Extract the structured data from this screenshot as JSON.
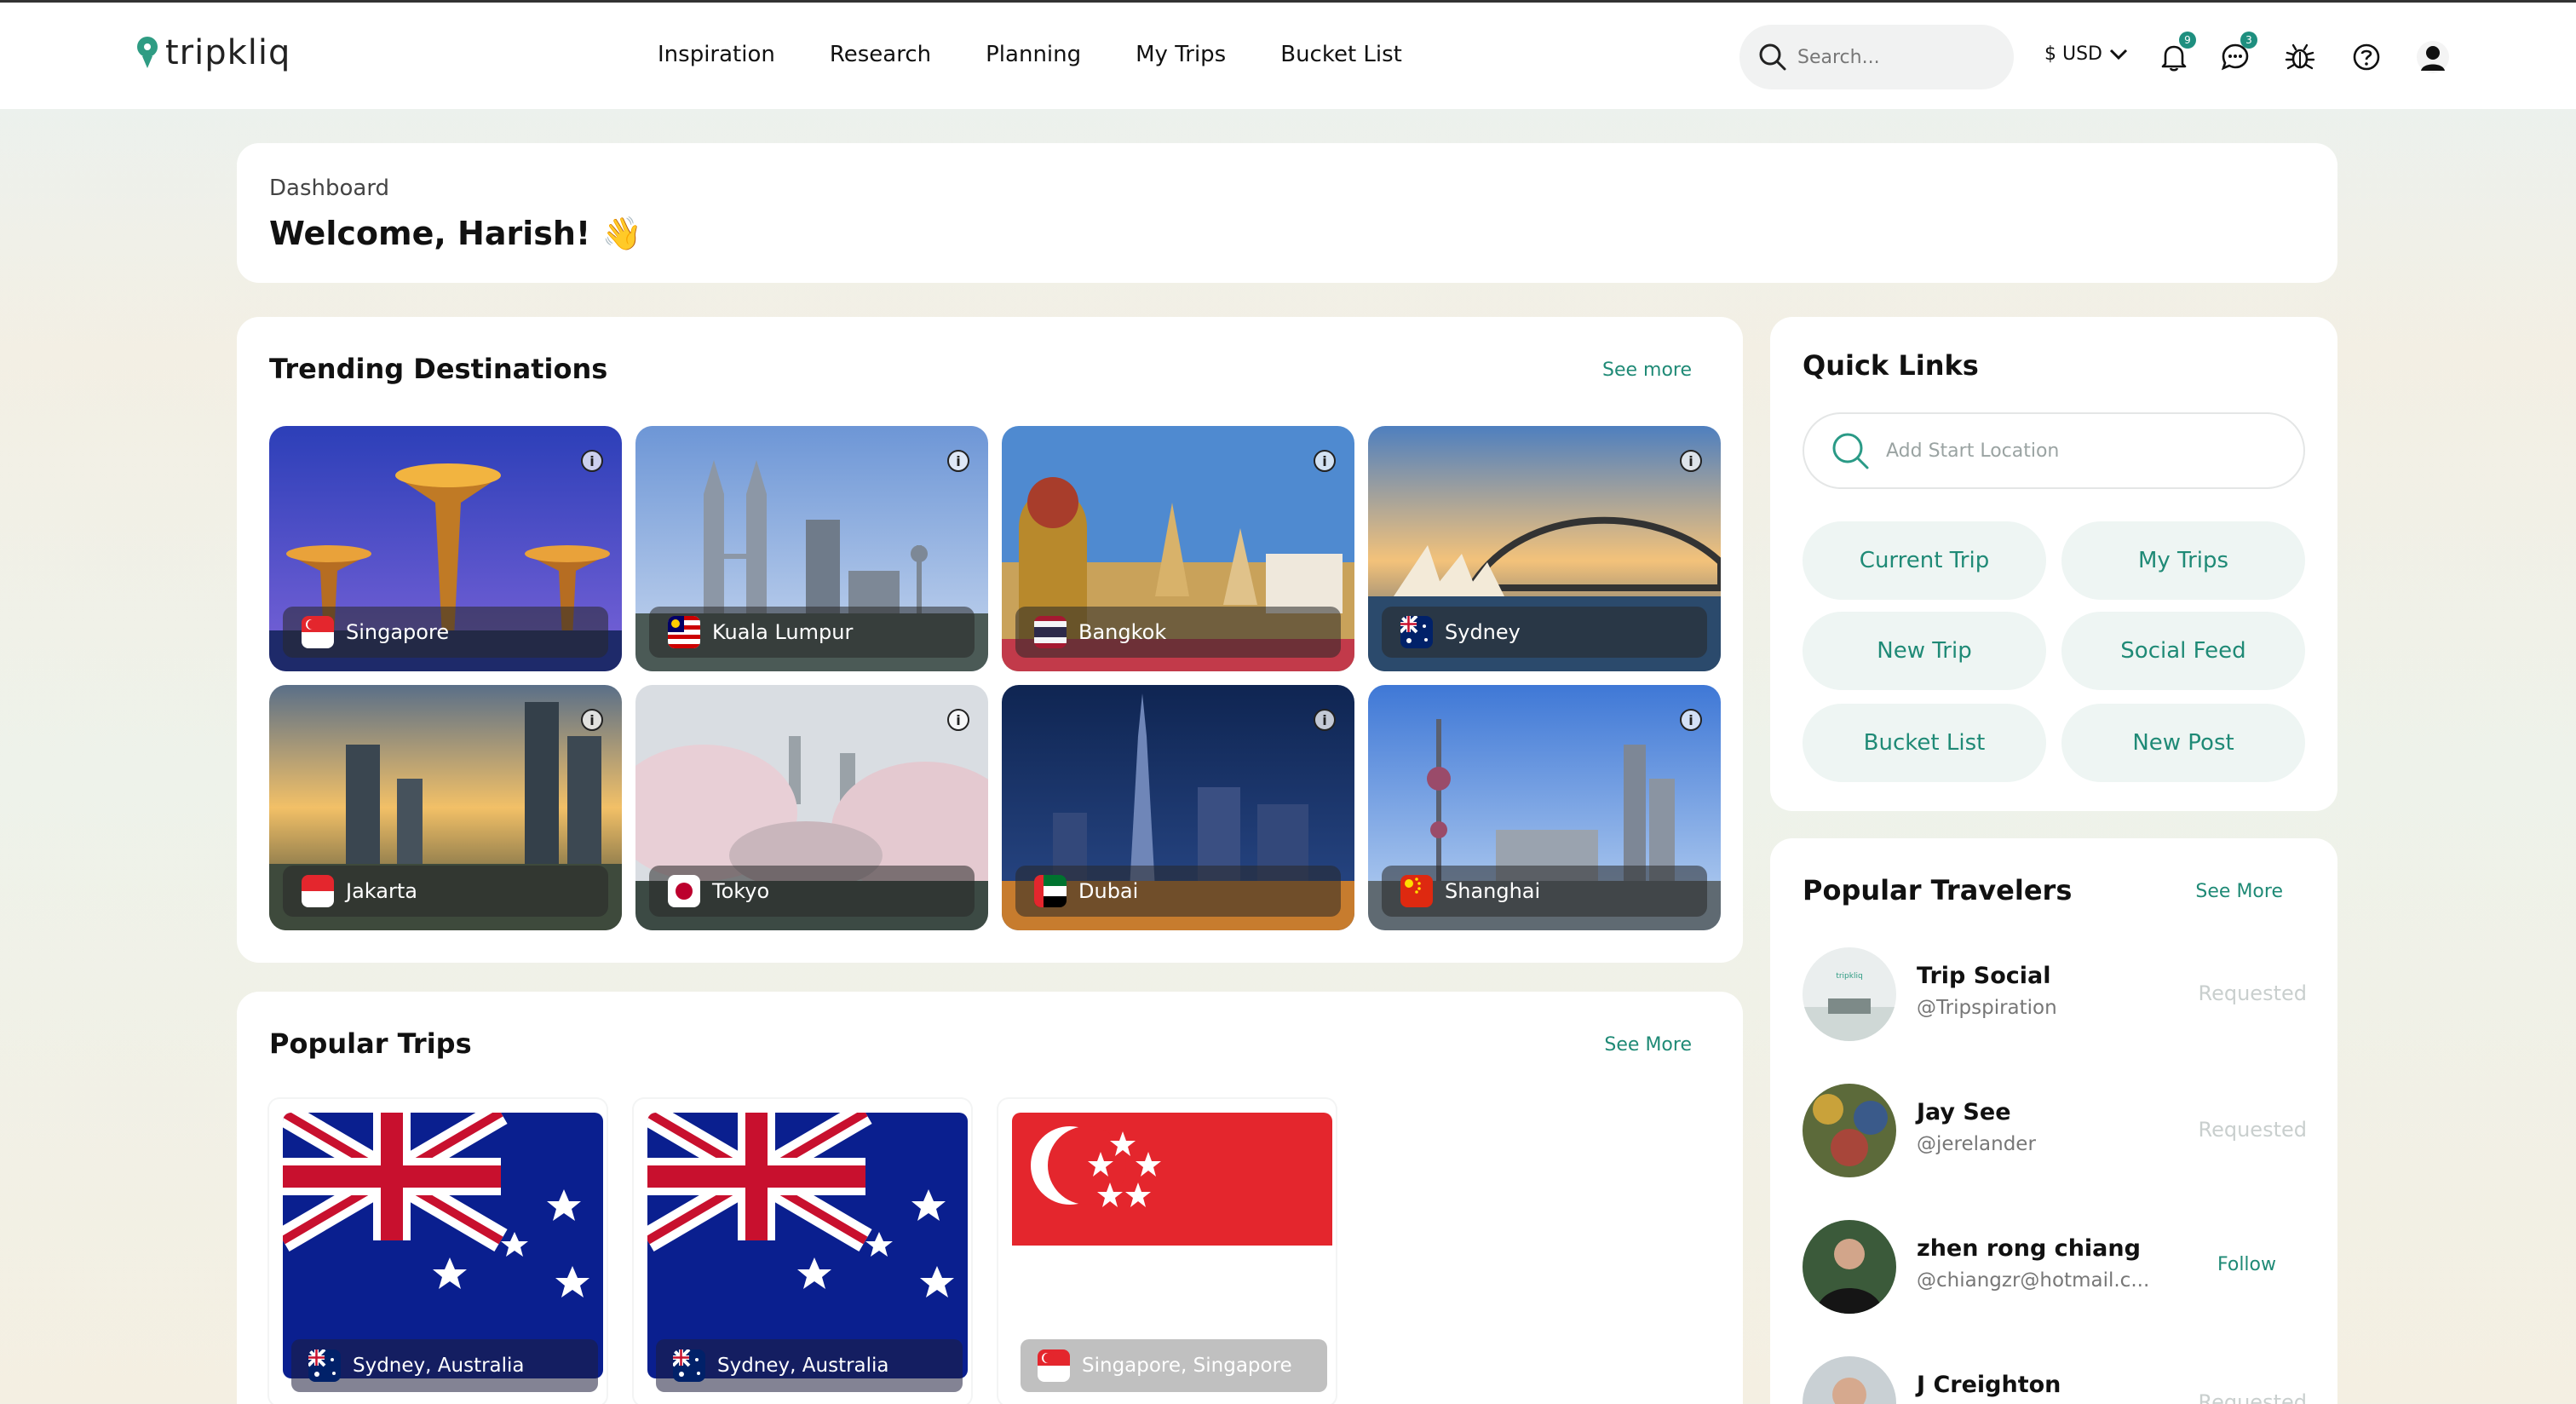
{
  "app": {
    "brand": "tripkliq"
  },
  "nav": {
    "items": [
      "Inspiration",
      "Research",
      "Planning",
      "My Trips",
      "Bucket List"
    ],
    "search_placeholder": "Search...",
    "currency": "$ USD",
    "notification_count": "9",
    "message_count": "3"
  },
  "dashboard": {
    "breadcrumb": "Dashboard",
    "welcome": "Welcome, Harish! 👋"
  },
  "trending": {
    "title": "Trending Destinations",
    "see_more": "See more",
    "destinations": [
      {
        "name": "Singapore",
        "flag": "flag-singapore"
      },
      {
        "name": "Kuala Lumpur",
        "flag": "flag-malaysia"
      },
      {
        "name": "Bangkok",
        "flag": "flag-thailand"
      },
      {
        "name": "Sydney",
        "flag": "flag-australia"
      },
      {
        "name": "Jakarta",
        "flag": "flag-indonesia"
      },
      {
        "name": "Tokyo",
        "flag": "flag-japan"
      },
      {
        "name": "Dubai",
        "flag": "flag-uae"
      },
      {
        "name": "Shanghai",
        "flag": "flag-china"
      }
    ]
  },
  "quick_links": {
    "title": "Quick Links",
    "start_placeholder": "Add Start Location",
    "buttons": [
      "Current Trip",
      "My Trips",
      "New Trip",
      "Social Feed",
      "Bucket List",
      "New Post"
    ]
  },
  "travelers": {
    "title": "Popular Travelers",
    "see_more": "See More",
    "list": [
      {
        "name": "Trip Social",
        "handle": "@Tripspiration",
        "action": "Requested"
      },
      {
        "name": "Jay See",
        "handle": "@jerelander",
        "action": "Requested"
      },
      {
        "name": "zhen rong chiang",
        "handle": "@chiangzr@hotmail.c...",
        "action": "Follow"
      },
      {
        "name": "J Creighton",
        "handle": "",
        "action": "Requested"
      }
    ]
  },
  "popular_trips": {
    "title": "Popular Trips",
    "see_more": "See More",
    "trips": [
      {
        "location": "Sydney, Australia",
        "flag": "flag-australia"
      },
      {
        "location": "Sydney, Australia",
        "flag": "flag-australia"
      },
      {
        "location": "Singapore, Singapore",
        "flag": "flag-singapore"
      }
    ]
  },
  "colors": {
    "accent": "#1f8a76",
    "pill_bg": "#eef5f3"
  }
}
